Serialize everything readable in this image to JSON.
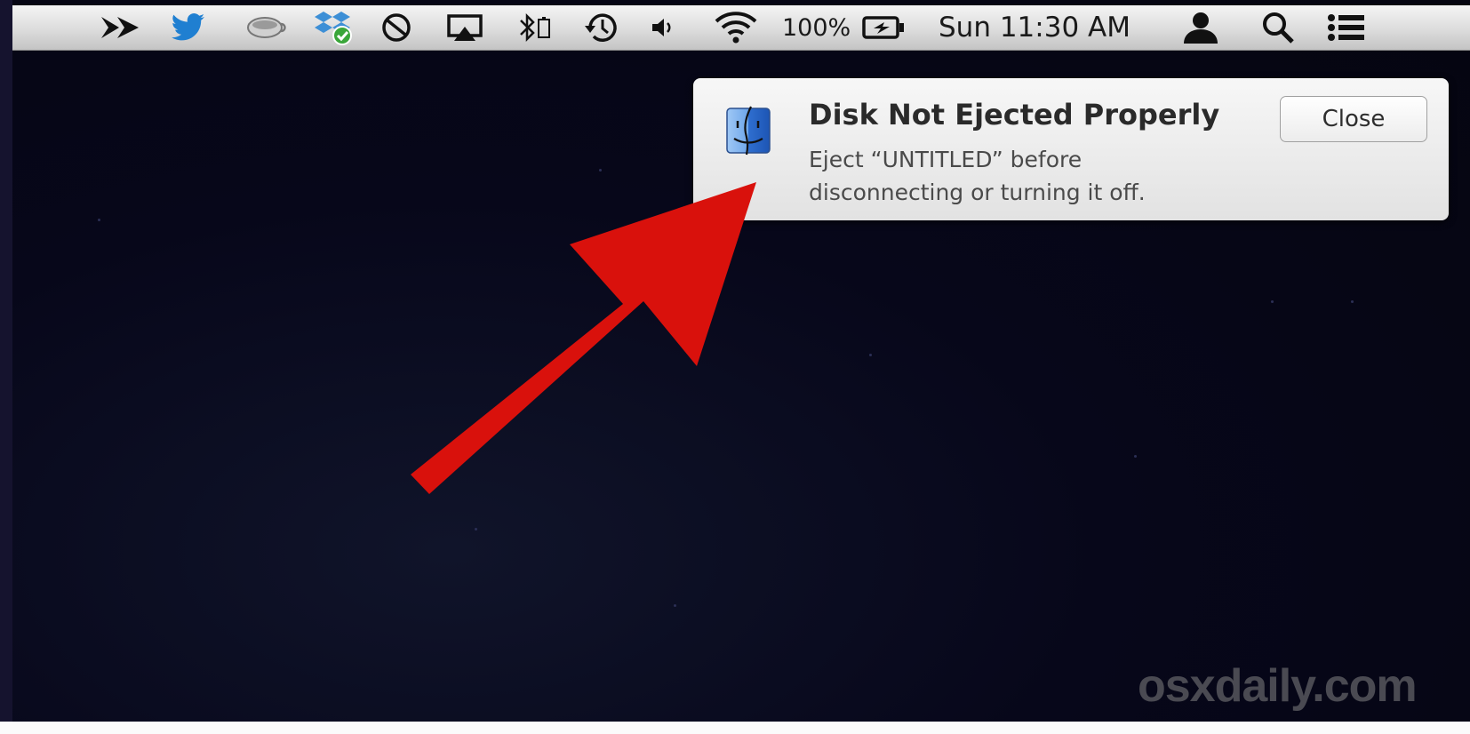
{
  "menubar": {
    "icons": [
      "fast-forward-icon",
      "twitter-bird-icon",
      "coffee-cup-icon",
      "dropbox-synced-icon",
      "do-not-disturb-icon",
      "airplay-icon",
      "bluetooth-icon",
      "time-machine-icon",
      "volume-icon",
      "wifi-icon",
      "battery-charging-icon",
      "user-icon",
      "spotlight-search-icon",
      "notification-center-icon"
    ],
    "battery_percent": "100%",
    "clock": "Sun 11:30 AM"
  },
  "notification": {
    "app_icon": "finder-icon",
    "title": "Disk Not Ejected Properly",
    "message_line_1": "Eject “UNTITLED” before",
    "message_line_2": "disconnecting or turning it off.",
    "close_label": "Close"
  },
  "annotation": {
    "arrow_color": "#d9110c"
  },
  "watermark": "osxdaily.com"
}
